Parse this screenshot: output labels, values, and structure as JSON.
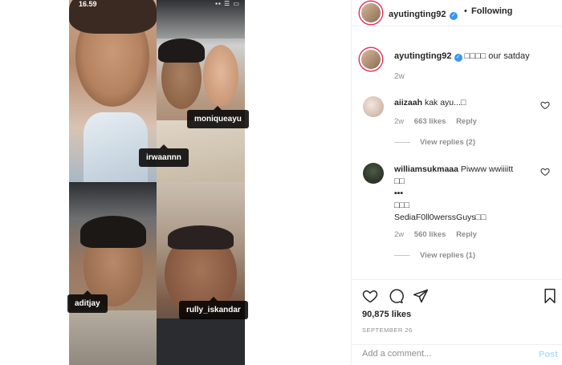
{
  "media": {
    "status_time": "16.59",
    "status_icons": "▪▪ ☰ ▭",
    "tags": {
      "irwaannn": "irwaannn",
      "moniqueayu": "moniqueayu",
      "aditjay": "aditjay",
      "rully_iskandar": "rully_iskandar"
    }
  },
  "header": {
    "username": "ayutingting92",
    "verified_icon": "check-badge-icon",
    "separator": "•",
    "follow_status": "Following"
  },
  "caption": {
    "username": "ayutingting92",
    "text": "□□□□ our satday",
    "time": "2w"
  },
  "comments": [
    {
      "username": "aiizaah",
      "text": "kak ayu...□",
      "time": "2w",
      "likes": "663 likes",
      "reply": "Reply",
      "view_replies": "View replies (2)"
    },
    {
      "username": "williamsukmaaa",
      "text_line1": "Piwww wwiiiitt",
      "text_line2": "□□",
      "text_line3": "•••",
      "text_line4": "□□□",
      "text_line5": "SediaF0ll0werssGuys□□",
      "time": "2w",
      "likes": "560 likes",
      "reply": "Reply",
      "view_replies": "View replies (1)"
    }
  ],
  "actions": {
    "likes": "90,875 likes",
    "date": "SEPTEMBER 26",
    "add_comment_placeholder": "Add a comment...",
    "post_label": "Post"
  },
  "colors": {
    "accent_blue": "#3897f0",
    "post_disabled": "#b2dffc",
    "muted_text": "#8e8e8e",
    "border": "#efefef"
  }
}
